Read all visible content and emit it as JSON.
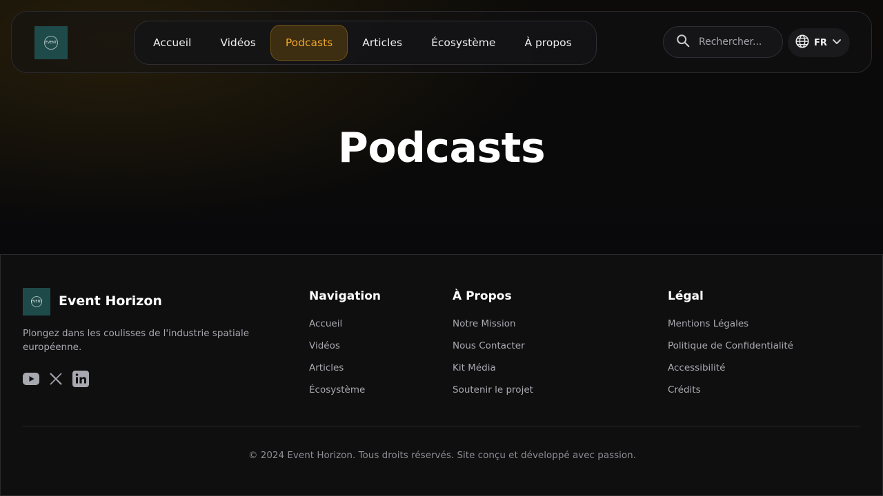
{
  "header": {
    "logo_text": "EVENT",
    "nav": [
      {
        "label": "Accueil"
      },
      {
        "label": "Vidéos"
      },
      {
        "label": "Podcasts"
      },
      {
        "label": "Articles"
      },
      {
        "label": "Écosystème"
      },
      {
        "label": "À propos"
      }
    ],
    "active_nav": "Podcasts",
    "search_placeholder": "Rechercher...",
    "language": "FR"
  },
  "main": {
    "title": "Podcasts"
  },
  "footer": {
    "brand": "Event Horizon",
    "tagline": "Plongez dans les coulisses de l'industrie spatiale européenne.",
    "socials": [
      "youtube-icon",
      "x-icon",
      "linkedin-icon"
    ],
    "columns": [
      {
        "title": "Navigation",
        "links": [
          "Accueil",
          "Vidéos",
          "Articles",
          "Écosystème"
        ]
      },
      {
        "title": "À Propos",
        "links": [
          "Notre Mission",
          "Nous Contacter",
          "Kit Média",
          "Soutenir le projet"
        ]
      },
      {
        "title": "Légal",
        "links": [
          "Mentions Légales",
          "Politique de Confidentialité",
          "Accessibilité",
          "Crédits"
        ]
      }
    ],
    "copyright": "© 2024 Event Horizon. Tous droits réservés. Site conçu et développé avec passion."
  },
  "colors": {
    "accent": "#f0a72a",
    "background": "#07070a",
    "logo_bg": "#1f4a4a"
  }
}
